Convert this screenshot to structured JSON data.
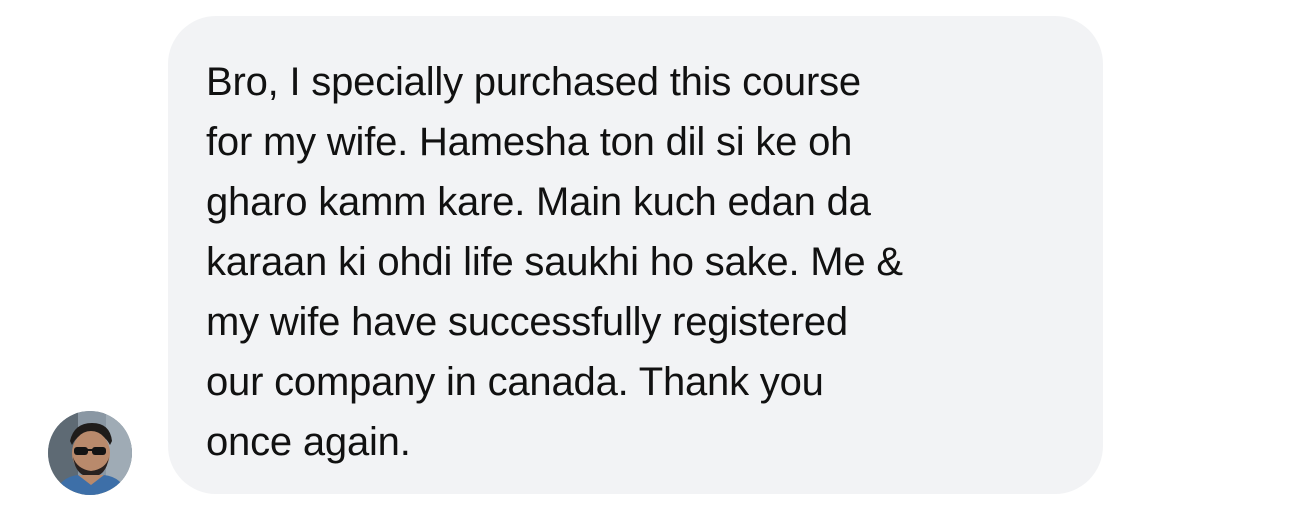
{
  "conversation": {
    "message": {
      "sender_avatar_icon": "user-avatar-photo",
      "text": "Bro, I specially purchased this course\nfor my wife. Hamesha ton dil si ke oh\ngharo kamm kare. Main kuch edan da\nkaraan ki ohdi life saukhi ho sake. Me &\nmy wife have successfully registered\nour company in canada. Thank you\nonce again.",
      "bubble_color": "#f2f3f5",
      "text_color": "#111111"
    }
  }
}
